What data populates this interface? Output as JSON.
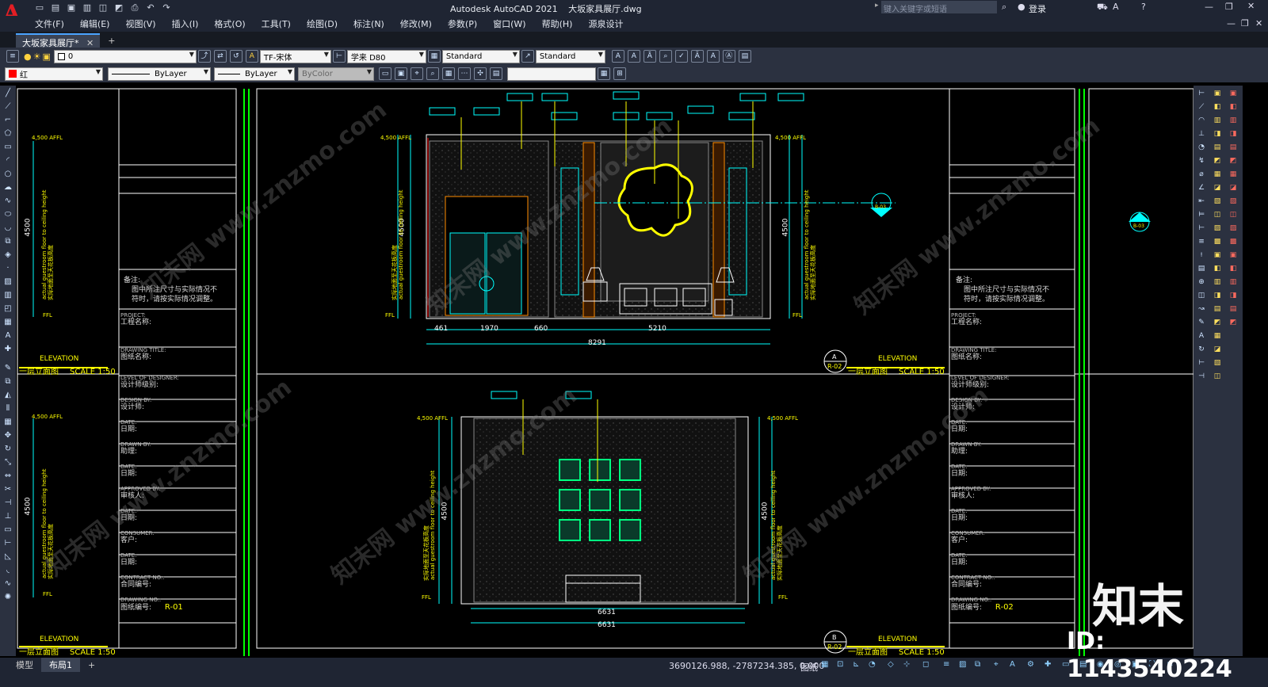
{
  "title_bar": {
    "app_title": "Autodesk AutoCAD 2021",
    "file_name": "大坂家具展厅.dwg",
    "search_placeholder": "键入关键字或短语",
    "login_label": "登录"
  },
  "menu": {
    "items": [
      "文件(F)",
      "编辑(E)",
      "视图(V)",
      "插入(I)",
      "格式(O)",
      "工具(T)",
      "绘图(D)",
      "标注(N)",
      "修改(M)",
      "参数(P)",
      "窗口(W)",
      "帮助(H)",
      "源泉设计"
    ]
  },
  "doc_tabs": {
    "active": "大坂家具展厅*",
    "add_symbol": "+"
  },
  "toolbar1": {
    "layer_value": "0",
    "text_style": "TF-宋体",
    "dim_style": "学来 D80",
    "table_style": "Standard",
    "multileader_style": "Standard"
  },
  "toolbar2": {
    "color_value": "红",
    "linetype": "ByLayer",
    "lineweight": "ByLayer",
    "plotstyle": "ByColor"
  },
  "drawing": {
    "notes_label": "备注:",
    "notes_text_1": "图中所注尺寸与实际情况不",
    "notes_text_2": "符时，请按实际情况调整。",
    "project_en": "PROJECT:",
    "project_cn": "工程名称:",
    "drawing_title_en": "DRAWING TITLE:",
    "drawing_title_cn": "图纸名称:",
    "level_en": "LEVEL OF DESIGNER:",
    "level_cn": "设计师级别:",
    "design_by_en": "DESIGN BY:",
    "design_by_cn": "设计师:",
    "date_en": "DATE:",
    "date_cn": "日期:",
    "drawn_by_en": "DRAWN BY:",
    "drawn_by_cn": "助理:",
    "approved_en": "APPROVED BY:",
    "approved_cn": "审核人:",
    "consumer_en": "CONSUMER:",
    "consumer_cn": "客户:",
    "contract_en": "CONTRACT NO.:",
    "contract_cn": "合同编号:",
    "drawing_no_en": "DRAWING NO.:",
    "drawing_no_cn": "图纸编号:",
    "drawing_no_left": "R-01",
    "drawing_no_right": "R-02",
    "elevation_label": "ELEVATION",
    "floor_label": "一层立面图",
    "scale_label": "SCALE 1:50",
    "view_a_letter": "A",
    "view_a_ref": "R-02",
    "view_b_letter": "B",
    "view_b_ref": "R-02",
    "height_label": "4500",
    "vertical_note_en": "actual guestroom floor to ceiling height",
    "vertical_note_cn": "实际地面至天花板高度",
    "dim_a_1": "461",
    "dim_a_2": "1970",
    "dim_a_3": "660",
    "dim_a_4": "5210",
    "dim_a_total": "8291",
    "dim_b_1": "6631",
    "dim_b_2": "6631",
    "level_top": "4,500 AFFL",
    "level_floor": "FFL",
    "section_tag": "B-03"
  },
  "status_bar": {
    "layout_model": "模型",
    "layout_1": "布局1",
    "coordinates": "3690126.988, -2787234.385, 0.000",
    "paper_label": "图纸"
  },
  "watermark": {
    "site_text": "知末网 www.znzmo.com",
    "brand": "知末",
    "id_text": "ID: 1143540224"
  },
  "colors": {
    "title_bg": "#1f2533",
    "canvas_bg": "#000000",
    "cad_yellow": "#ffff00",
    "cad_cyan": "#00ffff",
    "cad_green": "#00ff00",
    "cad_white": "#ffffff",
    "accent_red": "#e31e24"
  }
}
